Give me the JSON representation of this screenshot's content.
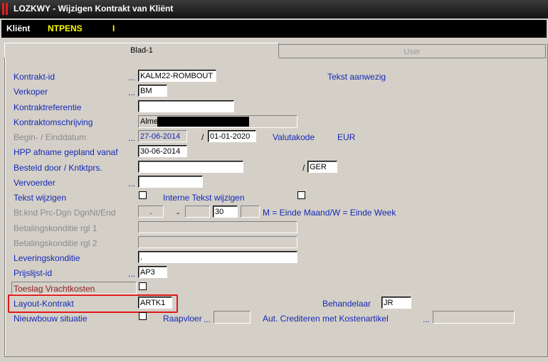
{
  "window": {
    "title": "LOZKWY - Wijzigen Kontrakt van Kliënt"
  },
  "client_bar": {
    "label": "Kliënt",
    "code": "NTPENS",
    "suffix": "I"
  },
  "tabs": [
    {
      "label": "Blad-1"
    },
    {
      "label": "User"
    }
  ],
  "form": {
    "kontrakt_id": {
      "label": "Kontrakt-id",
      "value": "KALM22-ROMBOUT"
    },
    "tekst_aanwezig": "Tekst aanwezig",
    "verkoper": {
      "label": "Verkoper",
      "value": "BM"
    },
    "kontraktreferentie": {
      "label": "Kontraktreferentie",
      "value": ""
    },
    "kontraktomschrijving": {
      "label": "Kontraktomschrijving",
      "value": "Alme"
    },
    "begin_einddatum": {
      "label": "Begin- / Einddatum",
      "begin": "27-06-2014",
      "sep": "/",
      "eind": "01-01-2020"
    },
    "valutakode": {
      "label": "Valutakode",
      "value": "EUR"
    },
    "hpp": {
      "label": "HPP afname gepland vanaf",
      "value": "30-06-2014"
    },
    "besteld_door": {
      "label": "Besteld door / Kntktprs.",
      "value": "",
      "sep": "/",
      "value2": "GER"
    },
    "vervoerder": {
      "label": "Vervoerder",
      "value": ""
    },
    "tekst_wijzigen": {
      "label": "Tekst wijzigen"
    },
    "interne_tekst": {
      "label": "Interne Tekst wijzigen"
    },
    "btknd": {
      "label": "Bt.knd Prc-Dgn DgnNt/End",
      "v1": ".",
      "dash": "-",
      "v2": "",
      "v3": "30",
      "v4": "",
      "note": "M = Einde Maand/W = Einde Week"
    },
    "betalingskonditie1": {
      "label": "Betalingskonditie rgl 1",
      "value": ""
    },
    "betalingskonditie2": {
      "label": "Betalingskonditie rgl 2",
      "value": ""
    },
    "leveringskonditie": {
      "label": "Leveringskonditie",
      "value": "."
    },
    "prijslijst": {
      "label": "Prijslijst-id",
      "value": "AP3"
    },
    "toeslag": {
      "label": "Toeslag Vrachtkosten"
    },
    "layout": {
      "label": "Layout-Kontrakt",
      "value": "ARTK1"
    },
    "behandelaar": {
      "label": "Behandelaar",
      "value": "JR"
    },
    "nieuwbouw": {
      "label": "Nieuwbouw situatie"
    },
    "raapvloer": {
      "label": "Raapvloer",
      "value": ""
    },
    "aut_crediteren": {
      "label": "Aut. Crediteren met Kostenartikel",
      "value": ""
    },
    "dots": "..."
  },
  "colors": {
    "label_blue": "#1428b4",
    "highlight_red": "#e01818",
    "client_yellow": "#ffff00"
  }
}
